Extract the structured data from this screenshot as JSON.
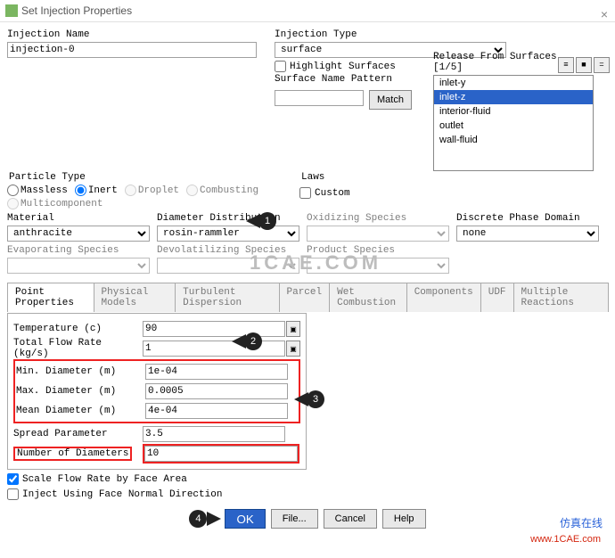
{
  "window": {
    "title": "Set Injection Properties"
  },
  "form": {
    "injection_name_label": "Injection Name",
    "injection_name_value": "injection-0",
    "injection_type_label": "Injection Type",
    "injection_type_value": "surface",
    "highlight_label": "Highlight Surfaces",
    "pattern_label": "Surface Name Pattern",
    "pattern_value": "",
    "match_btn": "Match"
  },
  "release": {
    "title": "Release From Surfaces [1/5]",
    "items": [
      "inlet-y",
      "inlet-z",
      "interior-fluid",
      "outlet",
      "wall-fluid"
    ],
    "selected_index": 1
  },
  "particle_type": {
    "legend": "Particle Type",
    "options": [
      "Massless",
      "Inert",
      "Droplet",
      "Combusting",
      "Multicomponent"
    ],
    "checked_index": 1
  },
  "laws": {
    "legend": "Laws",
    "custom_label": "Custom"
  },
  "material": {
    "label": "Material",
    "value": "anthracite"
  },
  "diameter_dist": {
    "label": "Diameter Distribution",
    "value": "rosin-rammler"
  },
  "oxidizing": {
    "label": "Oxidizing Species",
    "value": ""
  },
  "discrete": {
    "label": "Discrete Phase Domain",
    "value": "none"
  },
  "evap": {
    "label": "Evaporating Species"
  },
  "devol": {
    "label": "Devolatilizing Species"
  },
  "product": {
    "label": "Product Species"
  },
  "tabs": [
    "Point Properties",
    "Physical Models",
    "Turbulent Dispersion",
    "Parcel",
    "Wet Combustion",
    "Components",
    "UDF",
    "Multiple Reactions"
  ],
  "props": {
    "temperature": {
      "label": "Temperature (c)",
      "value": "90"
    },
    "total_flow": {
      "label": "Total Flow Rate (kg/s)",
      "value": "1"
    },
    "min_dia": {
      "label": "Min. Diameter (m)",
      "value": "1e-04"
    },
    "max_dia": {
      "label": "Max. Diameter (m)",
      "value": "0.0005"
    },
    "mean_dia": {
      "label": "Mean Diameter (m)",
      "value": "4e-04"
    },
    "spread": {
      "label": "Spread Parameter",
      "value": "3.5"
    },
    "num_dia": {
      "label": "Number of Diameters",
      "value": "10"
    }
  },
  "scale_label": "Scale Flow Rate by Face Area",
  "inject_normal_label": "Inject Using Face Normal Direction",
  "buttons": {
    "ok": "OK",
    "file": "File...",
    "cancel": "Cancel",
    "help": "Help"
  },
  "watermark": {
    "zh": "仿真在线",
    "url": "www.1CAE.com"
  },
  "callouts": {
    "c1": "1",
    "c2": "2",
    "c3": "3",
    "c4": "4"
  }
}
